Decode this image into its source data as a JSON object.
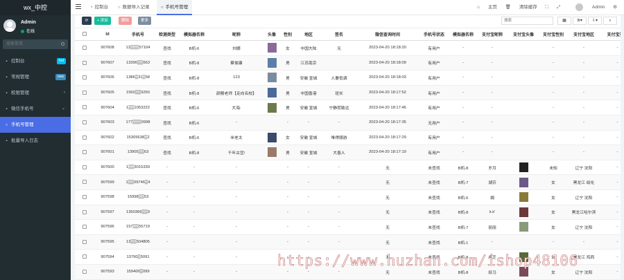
{
  "brand": "wx_中控",
  "user": {
    "name": "Admin",
    "status": "在线"
  },
  "search": {
    "placeholder": "搜索菜单"
  },
  "menu": [
    {
      "label": "控制台",
      "icon": "dashboard-icon",
      "badge": "hot",
      "badge_color": "#00c0ef"
    },
    {
      "label": "常规管理",
      "icon": "cog-icon",
      "badge": "new",
      "badge_color": "#3c8dbc"
    },
    {
      "label": "权限管理",
      "icon": "users-icon",
      "chev": "‹"
    },
    {
      "label": "微信手机号",
      "icon": "wechat-icon",
      "chev": "⌄"
    },
    {
      "label": "手机号管理",
      "icon": "circle-icon",
      "active": true
    },
    {
      "label": "批量导入日志",
      "icon": "list-icon"
    }
  ],
  "tabs": [
    {
      "label": "控制台",
      "icon": "dashboard-icon"
    },
    {
      "label": "数据导入记录",
      "icon": "circle-icon"
    },
    {
      "label": "手机号管理",
      "icon": "circle-icon",
      "active": true
    }
  ],
  "topright": {
    "home": "主页",
    "clear_cache": "清除缓存",
    "admin": "Admin"
  },
  "toolbar": {
    "add": "+ 添加",
    "delete": "删除",
    "more": "更多",
    "search_placeholder": "搜索"
  },
  "columns": [
    "",
    "Id",
    "手机号",
    "检测类型",
    "模拟器名称",
    "昵称",
    "头像",
    "性别",
    "地区",
    "签名",
    "微信查询时间",
    "手机号状态",
    "模拟器名称",
    "支付宝昵称",
    "支付宝头像",
    "支付宝性别",
    "支付宝地区",
    "支付宝签名"
  ],
  "rows": [
    {
      "id": "907608",
      "phone": "13▒▒▒57104",
      "type": "查找",
      "sim": "B机-6",
      "nick": "刘娜",
      "avatar": "#8a6a9b",
      "sex": "女",
      "region": "中国大陆",
      "sign": "无",
      "time": "2023-04-20 18:18:20",
      "status": "有用户",
      "sim2": "-",
      "ali_nick": "-",
      "ali_avatar": "",
      "ali_sex": "-",
      "ali_region": "-",
      "ali_sign": "-"
    },
    {
      "id": "907607",
      "phone": "13390▒▒663",
      "type": "查找",
      "sim": "B机-8",
      "nick": "蔡俊康",
      "avatar": "#5a7fa8",
      "sex": "男",
      "region": "江苏南京",
      "sign": "",
      "time": "2023-04-20 18:18:09",
      "status": "有用户",
      "sim2": "-",
      "ali_nick": "-",
      "ali_avatar": "",
      "ali_sex": "-",
      "ali_region": "-",
      "ali_sign": "-"
    },
    {
      "id": "907606",
      "phone": "1386▒31▒58",
      "type": "查找",
      "sim": "B机-8",
      "nick": "123",
      "avatar": "#7a8ca0",
      "sex": "男",
      "region": "安徽 宣城",
      "sign": "人要低调",
      "time": "2023-04-20 18:18:03",
      "status": "有用户",
      "sim2": "-",
      "ali_nick": "-",
      "ali_avatar": "",
      "ali_sex": "-",
      "ali_region": "-",
      "ali_sign": "-"
    },
    {
      "id": "907605",
      "phone": "1560▒▒9250",
      "type": "查找",
      "sim": "B机-8",
      "nick": "颜務老师【走向名校】",
      "avatar": "#4a6a9a",
      "sex": "男",
      "region": "中国香港",
      "sign": "班长",
      "time": "2023-04-20 18:17:52",
      "status": "有用户",
      "sim2": "-",
      "ali_nick": "-",
      "ali_avatar": "",
      "ali_sex": "-",
      "ali_region": "-",
      "ali_sign": "-"
    },
    {
      "id": "907604",
      "phone": "1▒▒1053222",
      "type": "查找",
      "sim": "B机-6",
      "nick": "大海:",
      "avatar": "#6b7a4a",
      "sex": "男",
      "region": "安徽 宣城",
      "sign": "宁静而致远",
      "time": "2023-04-20 18:17:46",
      "status": "有用户",
      "sim2": "-",
      "ali_nick": "-",
      "ali_avatar": "",
      "ali_sex": "-",
      "ali_region": "-",
      "ali_sign": "-"
    },
    {
      "id": "907603",
      "phone": "177▒▒▒0998",
      "type": "查找",
      "sim": "B机-6",
      "nick": "-",
      "avatar": "",
      "sex": "-",
      "region": "-",
      "sign": "-",
      "time": "2023-04-20 18:17:35",
      "status": "无用户",
      "sim2": "-",
      "ali_nick": "-",
      "ali_avatar": "",
      "ali_sex": "-",
      "ali_region": "-",
      "ali_sign": "-"
    },
    {
      "id": "907602",
      "phone": "15305638▒2",
      "type": "查找",
      "sim": "B机-6",
      "nick": "米老太",
      "avatar": "#3a4a6a",
      "sex": "女",
      "region": "安徽 宣城",
      "sign": "唯得顺游",
      "time": "2023-04-20 18:17:29",
      "status": "有用户",
      "sim2": "-",
      "ali_nick": "-",
      "ali_avatar": "",
      "ali_sex": "-",
      "ali_region": "-",
      "ali_sign": "-"
    },
    {
      "id": "907601",
      "phone": "13905▒▒63",
      "type": "查找",
      "sim": "B机-8",
      "nick": "千年古宜!",
      "avatar": "#9a7a6a",
      "sex": "男",
      "region": "安徽 宣城",
      "sign": "大善人",
      "time": "2023-04-20 18:17:19",
      "status": "有用户",
      "sim2": "-",
      "ali_nick": "-",
      "ali_avatar": "",
      "ali_sex": "-",
      "ali_region": "-",
      "ali_sign": "-"
    },
    {
      "id": "907600",
      "phone": "1▒▒3015339",
      "type": "-",
      "sim": "-",
      "nick": "-",
      "avatar": "",
      "sex": "-",
      "region": "-",
      "sign": "-",
      "time": "无",
      "status": "未查找",
      "sim2": "B机-8",
      "ali_nick": "岁月",
      "ali_avatar": "#222222",
      "ali_sex": "未知",
      "ali_region": "辽宁 沈阳",
      "ali_sign": "-"
    },
    {
      "id": "907599",
      "phone": "1▒▒09746▒4",
      "type": "-",
      "sim": "-",
      "nick": "-",
      "avatar": "",
      "sex": "-",
      "region": "-",
      "sign": "-",
      "time": "无",
      "status": "未查找",
      "sim2": "B机-7",
      "ali_nick": "湖芬",
      "ali_avatar": "#6a5a8a",
      "ali_sex": "女",
      "ali_region": "黑龙江 绥化",
      "ali_sign": "-"
    },
    {
      "id": "907598",
      "phone": "15998▒▒53",
      "type": "-",
      "sim": "-",
      "nick": "-",
      "avatar": "",
      "sex": "-",
      "region": "-",
      "sign": "-",
      "time": "无",
      "status": "未查找",
      "sim2": "B机-6",
      "ali_nick": "娟",
      "ali_avatar": "#8a7a3a",
      "ali_sex": "女",
      "ali_region": "辽宁 沈阳",
      "ali_sign": "-"
    },
    {
      "id": "907597",
      "phone": "1350366▒▒9",
      "type": "-",
      "sim": "-",
      "nick": "-",
      "avatar": "",
      "sex": "-",
      "region": "-",
      "sign": "-",
      "time": "无",
      "status": "未查找",
      "sim2": "B机-8",
      "ali_nick": "k.k'",
      "ali_avatar": "#6a3a3a",
      "ali_sex": "女",
      "ali_region": "黑龙江哈尔滨",
      "ali_sign": "-"
    },
    {
      "id": "907596",
      "phone": "157▒▒55719",
      "type": "-",
      "sim": "-",
      "nick": "-",
      "avatar": "",
      "sex": "-",
      "region": "-",
      "sign": "-",
      "time": "无",
      "status": "未查找",
      "sim2": "B机-7",
      "ali_nick": "丽丽",
      "ali_avatar": "#8a9a7a",
      "ali_sex": "女",
      "ali_region": "辽宁 沈阳",
      "ali_sign": "-"
    },
    {
      "id": "907595",
      "phone": "13▒▒504805",
      "type": "-",
      "sim": "-",
      "nick": "-",
      "avatar": "",
      "sex": "-",
      "region": "-",
      "sign": "-",
      "time": "无",
      "status": "未查找",
      "sim2": "B机-1",
      "ali_nick": "-",
      "ali_avatar": "",
      "ali_sex": "-",
      "ali_region": "-",
      "ali_sign": "-"
    },
    {
      "id": "907594",
      "phone": "13790▒5091",
      "type": "-",
      "sim": "-",
      "nick": "-",
      "avatar": "",
      "sex": "-",
      "region": "-",
      "sign": "-",
      "time": "无",
      "status": "未查找",
      "sim2": "B机-8",
      "ali_nick": "岚芝",
      "ali_avatar": "#5a6a3a",
      "ali_sex": "女",
      "ali_region": "黑龙江 鸡西",
      "ali_sign": "-"
    },
    {
      "id": "907593",
      "phone": "159400▒099",
      "type": "-",
      "sim": "-",
      "nick": "-",
      "avatar": "",
      "sex": "-",
      "region": "-",
      "sign": "-",
      "time": "无",
      "status": "未查找",
      "sim2": "B机-8",
      "ali_nick": "妖马",
      "ali_avatar": "#7a4a5a",
      "ali_sex": "女",
      "ali_region": "辽宁 沈阳",
      "ali_sign": "-"
    }
  ],
  "watermark": "https://www.huzhan.com/ishop48106"
}
